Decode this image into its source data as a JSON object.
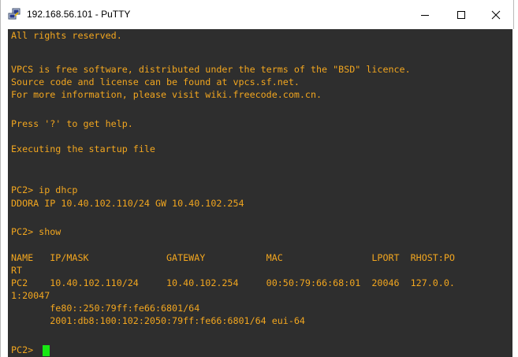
{
  "window": {
    "title": "192.168.56.101 - PuTTY",
    "icon": "putty-icon",
    "controls": {
      "minimize": "minimize-icon",
      "maximize": "maximize-icon",
      "close": "close-icon"
    }
  },
  "terminal": {
    "background": "#2e2e2e",
    "text_color": "#f2a61f",
    "cursor_color": "#17e812",
    "lines": [
      "All rights reserved.",
      "",
      "VPCS is free software, distributed under the terms of the \"BSD\" licence.",
      "Source code and license can be found at vpcs.sf.net.",
      "For more information, please visit wiki.freecode.com.cn.",
      "",
      "Press '?' to get help.",
      "",
      "Executing the startup file",
      "",
      "",
      "PC2> ip dhcp",
      "DDORA IP 10.40.102.110/24 GW 10.40.102.254",
      "",
      "PC2> show",
      "",
      "NAME   IP/MASK              GATEWAY           MAC                LPORT  RHOST:PO",
      "RT",
      "PC2    10.40.102.110/24     10.40.102.254     00:50:79:66:68:01  20046  127.0.0.",
      "1:20047",
      "       fe80::250:79ff:fe66:6801/64",
      "       2001:db8:100:102:2050:79ff:fe66:6801/64 eui-64",
      "",
      "PC2> "
    ]
  }
}
